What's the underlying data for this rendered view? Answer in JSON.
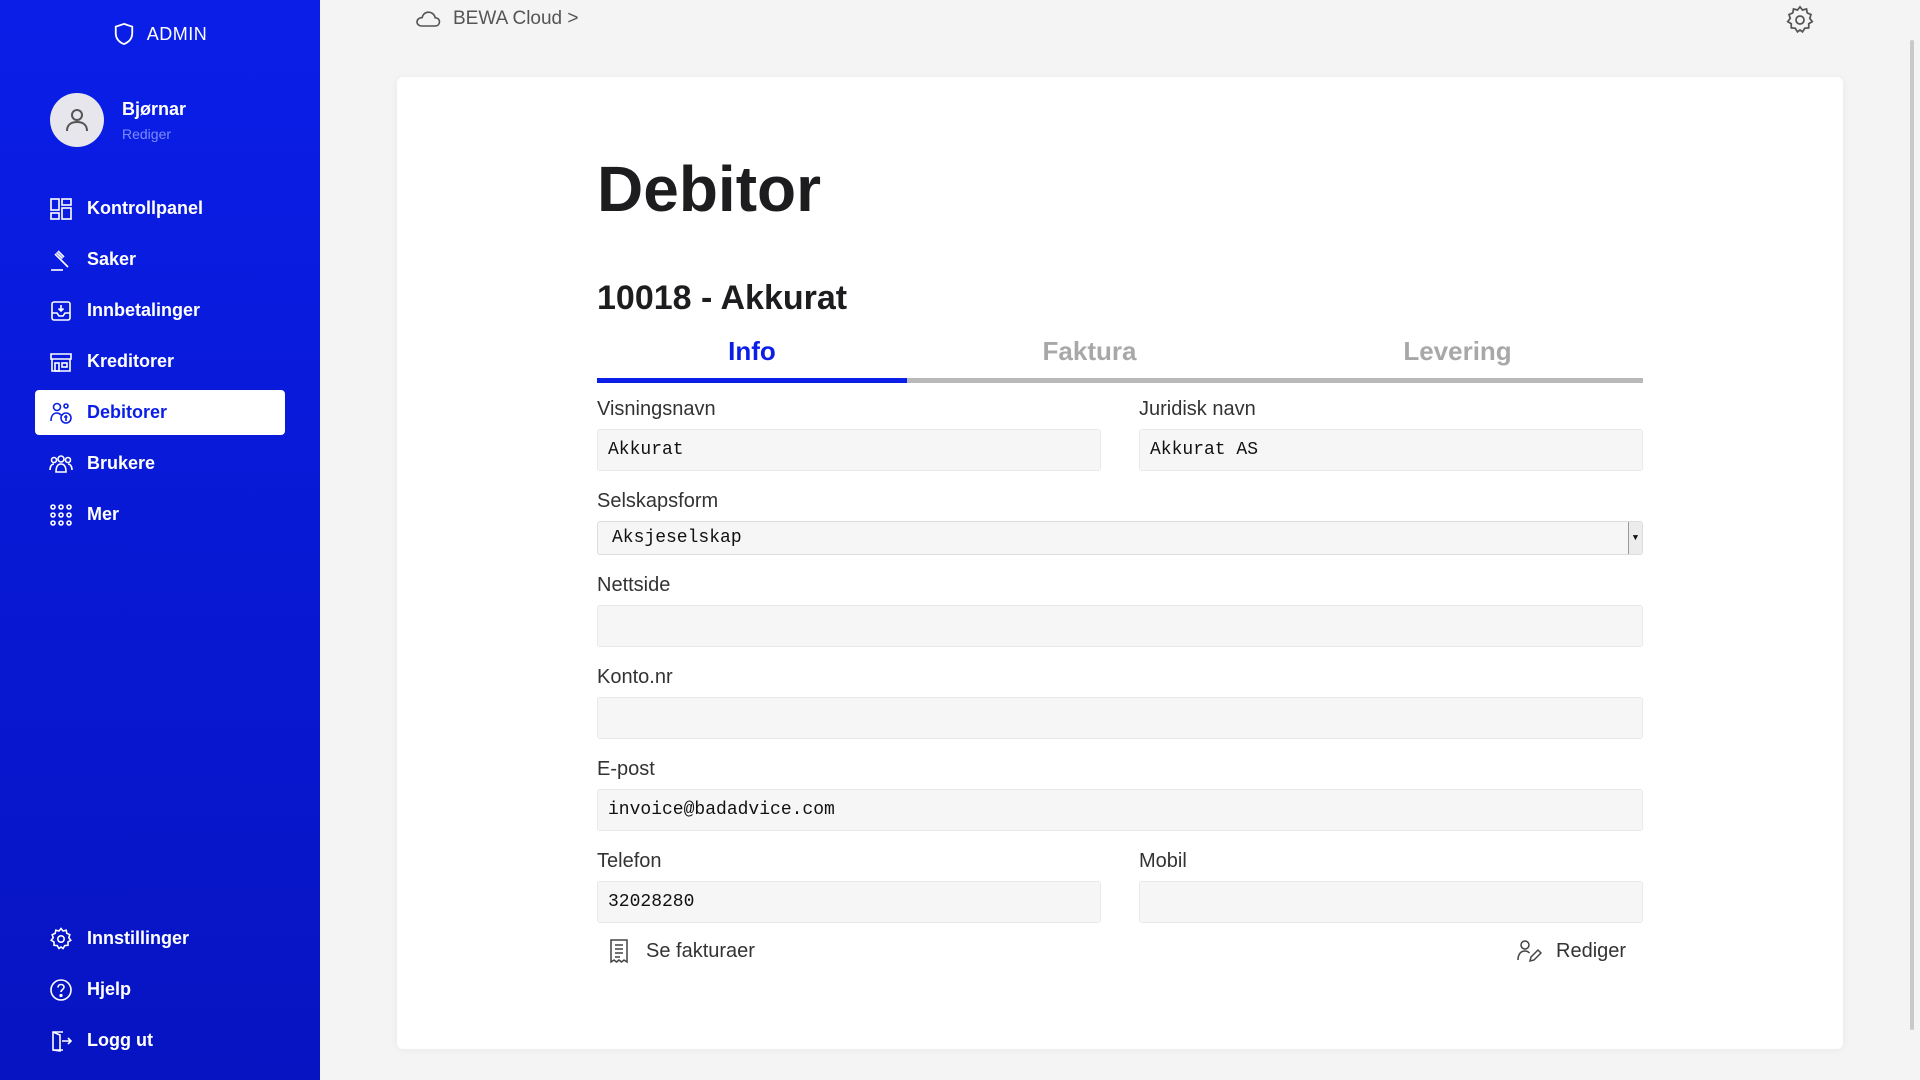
{
  "sidebar": {
    "brand": "ADMIN",
    "user": {
      "name": "Bjørnar",
      "edit_label": "Rediger"
    },
    "items": [
      {
        "label": "Kontrollpanel",
        "icon": "dashboard-icon"
      },
      {
        "label": "Saker",
        "icon": "gavel-icon"
      },
      {
        "label": "Innbetalinger",
        "icon": "payment-icon"
      },
      {
        "label": "Kreditorer",
        "icon": "store-icon"
      },
      {
        "label": "Debitorer",
        "icon": "debtor-icon",
        "active": true
      },
      {
        "label": "Brukere",
        "icon": "users-icon"
      },
      {
        "label": "Mer",
        "icon": "grid-icon"
      }
    ],
    "bottom_items": [
      {
        "label": "Innstillinger",
        "icon": "gear-icon"
      },
      {
        "label": "Hjelp",
        "icon": "help-icon"
      },
      {
        "label": "Logg ut",
        "icon": "logout-icon"
      }
    ]
  },
  "breadcrumb": {
    "text": "BEWA Cloud >"
  },
  "page": {
    "title": "Debitor",
    "subtitle": "10018 - Akkurat",
    "tabs": [
      "Info",
      "Faktura",
      "Levering"
    ],
    "active_tab": "Info"
  },
  "form": {
    "visningsnavn": {
      "label": "Visningsnavn",
      "value": "Akkurat"
    },
    "juridisk_navn": {
      "label": "Juridisk navn",
      "value": "Akkurat AS"
    },
    "selskapsform": {
      "label": "Selskapsform",
      "value": "Aksjeselskap"
    },
    "nettside": {
      "label": "Nettside",
      "value": ""
    },
    "konto_nr": {
      "label": "Konto.nr",
      "value": ""
    },
    "epost": {
      "label": "E-post",
      "value": "invoice@badadvice.com"
    },
    "telefon": {
      "label": "Telefon",
      "value": "32028280"
    },
    "mobil": {
      "label": "Mobil",
      "value": ""
    }
  },
  "actions": {
    "see_invoices": "Se fakturaer",
    "edit": "Rediger"
  },
  "colors": {
    "accent": "#0a1ee8",
    "sidebar_bg": "#0714c2"
  }
}
